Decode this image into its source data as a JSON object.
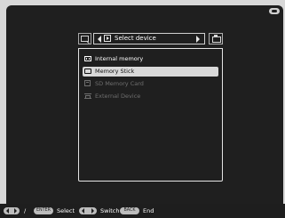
{
  "screen": {
    "brand_icon": "sony-logo-icon"
  },
  "header": {
    "left_icon": "folder-view-icon",
    "title": "Select device",
    "right_icon": "device-switch-icon",
    "nav_left_icon": "chevron-left-icon",
    "nav_right_icon": "chevron-right-icon"
  },
  "menu": {
    "items": [
      {
        "label": "Internal memory",
        "icon": "internal-memory-icon",
        "state": "enabled"
      },
      {
        "label": "Memory Stick",
        "icon": "memory-stick-icon",
        "state": "selected"
      },
      {
        "label": "SD Memory Card",
        "icon": "sd-card-icon",
        "state": "disabled"
      },
      {
        "label": "External Device",
        "icon": "usb-device-icon",
        "state": "disabled"
      }
    ]
  },
  "footer": {
    "items": [
      {
        "key": "dpad",
        "text": "/"
      },
      {
        "key": "ENTER",
        "text": "Select"
      },
      {
        "key": "switch",
        "text": "Switch"
      },
      {
        "key": "BACK",
        "text": "End"
      }
    ]
  },
  "colors": {
    "screen_bg": "#1f1f1f",
    "panel_border": "#e4e4e4",
    "selected_bg": "#d8d8d8",
    "disabled_text": "#6f6f6f",
    "footer_bg": "#1e1e1e"
  }
}
